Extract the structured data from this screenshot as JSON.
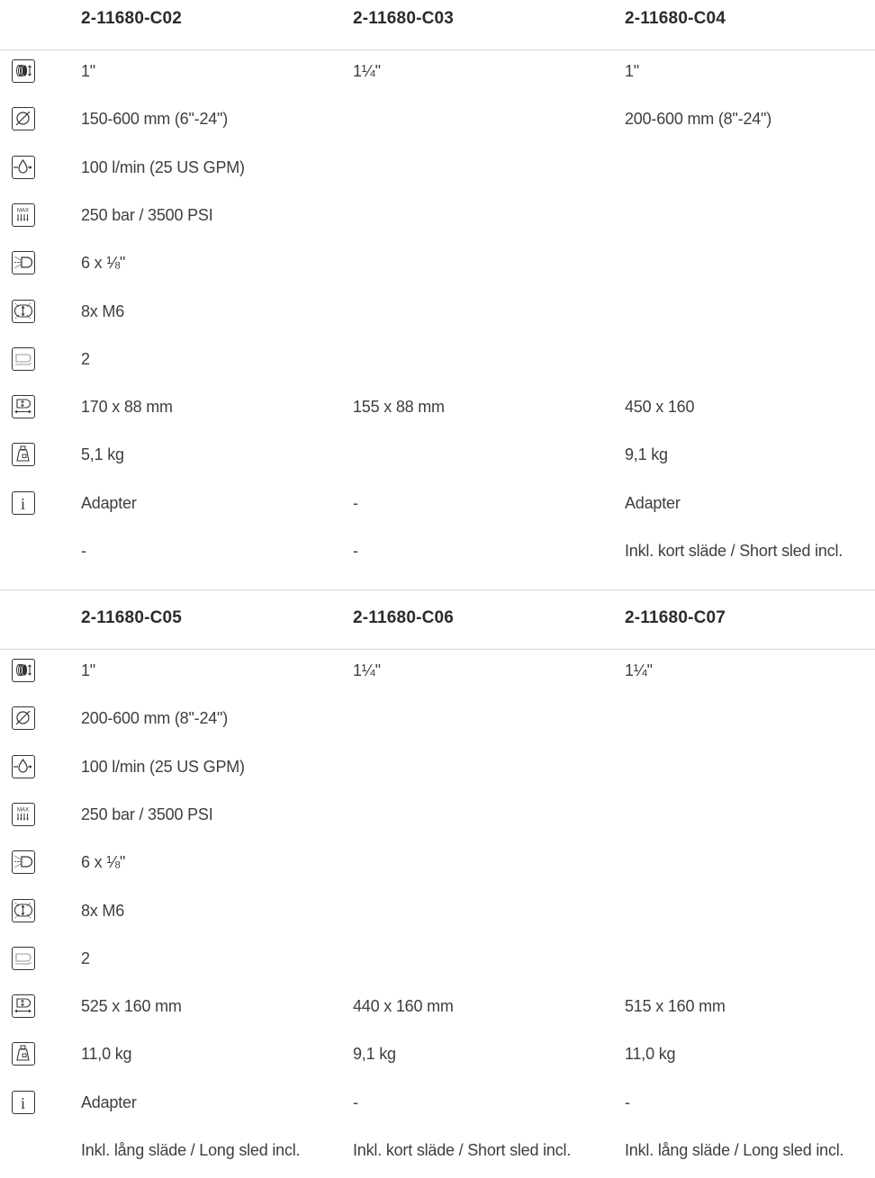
{
  "tables": [
    {
      "headers": [
        "2-11680-C02",
        "2-11680-C03",
        "2-11680-C04"
      ],
      "rows": [
        {
          "icon": "hose-reel-icon",
          "values": [
            "1\"",
            "1¼\"",
            "1\""
          ]
        },
        {
          "icon": "diameter-icon",
          "values": [
            "150-600 mm (6\"-24\")",
            "",
            "200-600 mm (8\"-24\")"
          ]
        },
        {
          "icon": "flow-rate-icon",
          "values": [
            "100 l/min (25 US GPM)",
            "",
            ""
          ]
        },
        {
          "icon": "max-pressure-icon",
          "values": [
            "250 bar / 3500 PSI",
            "",
            ""
          ]
        },
        {
          "icon": "nozzle-jets-icon",
          "values": [
            "6 x ⅛\"",
            "",
            ""
          ]
        },
        {
          "icon": "rotating-nozzle-icon",
          "values": [
            "8x M6",
            "",
            ""
          ]
        },
        {
          "icon": "sled-icon",
          "values": [
            "2",
            "",
            ""
          ]
        },
        {
          "icon": "dimensions-icon",
          "values": [
            "170 x 88 mm",
            "155 x 88 mm",
            "450 x 160"
          ]
        },
        {
          "icon": "weight-icon",
          "values": [
            "5,1 kg",
            "",
            "9,1 kg"
          ]
        },
        {
          "icon": "info-icon",
          "values": [
            "Adapter",
            "-",
            "Adapter"
          ]
        },
        {
          "icon": "",
          "values": [
            "-",
            "-",
            "Inkl. kort släde / Short sled incl."
          ]
        }
      ]
    },
    {
      "headers": [
        "2-11680-C05",
        "2-11680-C06",
        "2-11680-C07"
      ],
      "rows": [
        {
          "icon": "hose-reel-icon",
          "values": [
            "1\"",
            "1¼\"",
            "1¼\""
          ]
        },
        {
          "icon": "diameter-icon",
          "values": [
            "200-600 mm (8\"-24\")",
            "",
            ""
          ]
        },
        {
          "icon": "flow-rate-icon",
          "values": [
            "100 l/min (25 US GPM)",
            "",
            ""
          ]
        },
        {
          "icon": "max-pressure-icon",
          "values": [
            "250 bar / 3500 PSI",
            "",
            ""
          ]
        },
        {
          "icon": "nozzle-jets-icon",
          "values": [
            "6 x ⅛\"",
            "",
            ""
          ]
        },
        {
          "icon": "rotating-nozzle-icon",
          "values": [
            "8x M6",
            "",
            ""
          ]
        },
        {
          "icon": "sled-icon",
          "values": [
            "2",
            "",
            ""
          ]
        },
        {
          "icon": "dimensions-icon",
          "values": [
            "525 x 160 mm",
            "440 x 160 mm",
            "515 x 160 mm"
          ]
        },
        {
          "icon": "weight-icon",
          "values": [
            "11,0 kg",
            "9,1 kg",
            "11,0 kg"
          ]
        },
        {
          "icon": "info-icon",
          "values": [
            "Adapter",
            "-",
            "-"
          ]
        },
        {
          "icon": "",
          "values": [
            "Inkl. lång släde / Long sled incl.",
            "Inkl. kort släde / Short sled incl.",
            "Inkl. lång släde / Long sled incl."
          ]
        }
      ]
    }
  ]
}
